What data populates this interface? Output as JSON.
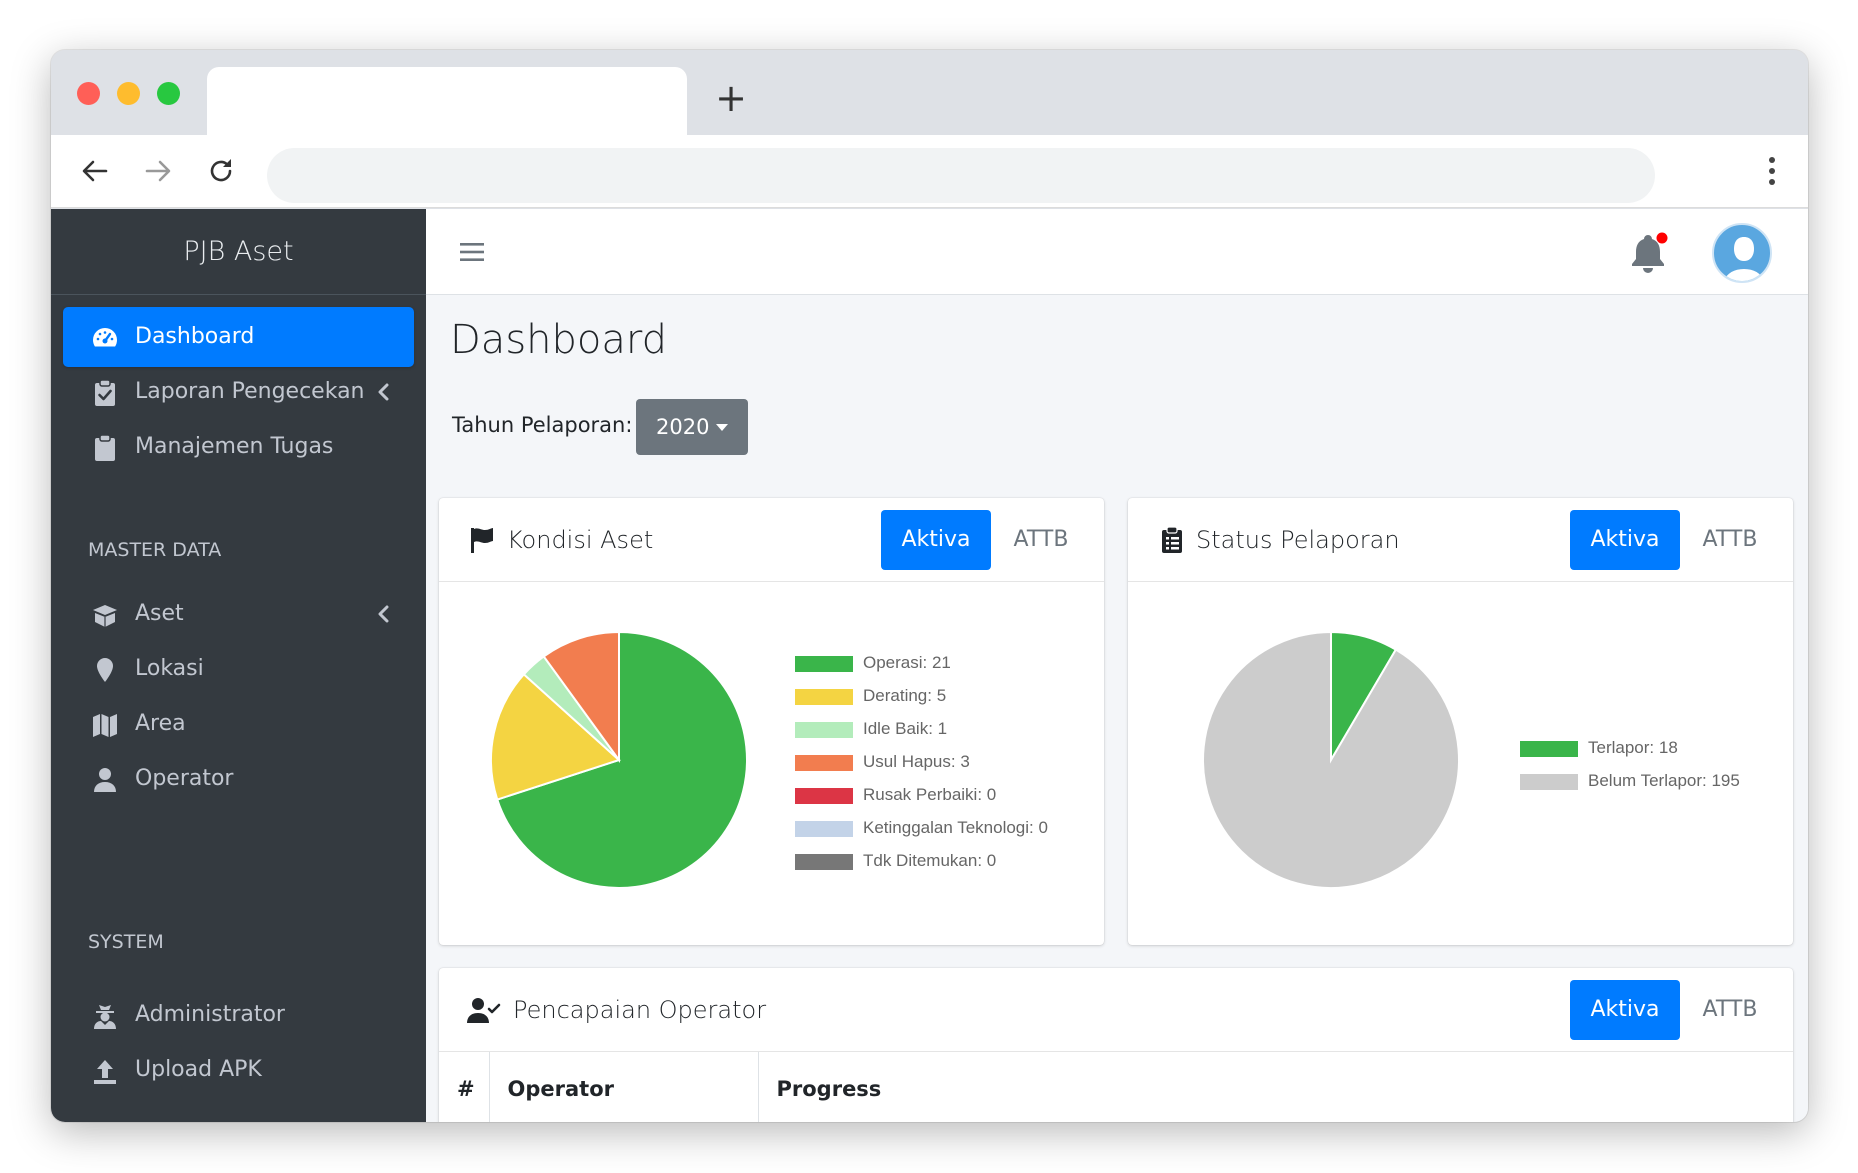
{
  "browser": {
    "new_tab_symbol": "+",
    "icons": [
      "arrow-left-icon",
      "arrow-right-icon",
      "reload-icon",
      "kebab-menu-icon"
    ]
  },
  "sidebar": {
    "brand": "PJB Aset",
    "items": [
      {
        "label": "Dashboard",
        "icon": "tachometer-icon",
        "active": true
      },
      {
        "label": "Laporan Pengecekan",
        "icon": "clipboard-check-icon",
        "has_submenu": true
      },
      {
        "label": "Manajemen Tugas",
        "icon": "clipboard-icon"
      }
    ],
    "section_master": "MASTER DATA",
    "master_items": [
      {
        "label": "Aset",
        "icon": "box-open-icon",
        "has_submenu": true
      },
      {
        "label": "Lokasi",
        "icon": "map-marker-icon"
      },
      {
        "label": "Area",
        "icon": "map-icon"
      },
      {
        "label": "Operator",
        "icon": "user-icon"
      }
    ],
    "section_system": "SYSTEM",
    "system_items": [
      {
        "label": "Administrator",
        "icon": "user-secret-icon"
      },
      {
        "label": "Upload APK",
        "icon": "upload-icon"
      }
    ]
  },
  "topnav": {
    "notification_dot_color": "#ff0000"
  },
  "main": {
    "title": "Dashboard",
    "year_label": "Tahun Pelaporan:",
    "year_value": "2020"
  },
  "cards": {
    "kondisi": {
      "title": "Kondisi Aset",
      "tab_active": "Aktiva",
      "tab_inactive": "ATTB"
    },
    "status": {
      "title": "Status Pelaporan",
      "tab_active": "Aktiva",
      "tab_inactive": "ATTB"
    },
    "pencapaian": {
      "title": "Pencapaian Operator",
      "tab_active": "Aktiva",
      "tab_inactive": "ATTB",
      "columns": [
        "#",
        "Operator",
        "Progress"
      ]
    }
  },
  "chart_data": [
    {
      "type": "pie",
      "title": "",
      "categories": [
        "Operasi",
        "Derating",
        "Idle Baik",
        "Usul Hapus",
        "Rusak Perbaiki",
        "Ketinggalan Teknologi",
        "Tdk Ditemukan"
      ],
      "values": [
        21,
        5,
        1,
        3,
        0,
        0,
        0
      ],
      "legend_labels": [
        "Operasi: 21",
        "Derating: 5",
        "Idle Baik: 1",
        "Usul Hapus: 3",
        "Rusak Perbaiki: 0",
        "Ketinggalan Teknologi: 0",
        "Tdk Ditemukan: 0"
      ],
      "colors": [
        "#3ab54a",
        "#f4d442",
        "#b3ecbb",
        "#f27d4f",
        "#dc3545",
        "#c3d3e8",
        "#777777"
      ],
      "legend_position": "right"
    },
    {
      "type": "pie",
      "title": "",
      "categories": [
        "Terlapor",
        "Belum Terlapor"
      ],
      "values": [
        18,
        195
      ],
      "legend_labels": [
        "Terlapor: 18",
        "Belum Terlapor: 195"
      ],
      "colors": [
        "#3ab54a",
        "#cccccc"
      ],
      "legend_position": "right"
    }
  ]
}
